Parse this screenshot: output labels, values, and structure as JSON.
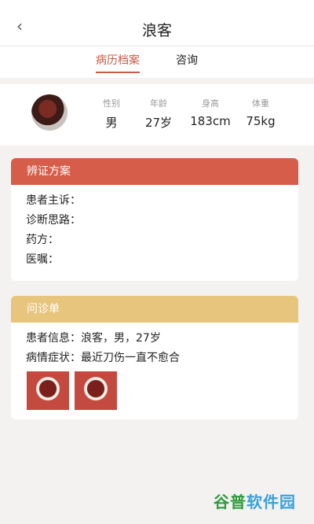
{
  "header": {
    "title": "浪客"
  },
  "tabs": [
    {
      "label": "病历档案",
      "active": true
    },
    {
      "label": "咨询",
      "active": false
    }
  ],
  "profile": {
    "stats": [
      {
        "label": "性别",
        "value": "男"
      },
      {
        "label": "年龄",
        "value": "27岁"
      },
      {
        "label": "身高",
        "value": "183cm"
      },
      {
        "label": "体重",
        "value": "75kg"
      }
    ]
  },
  "plan": {
    "title": "辨证方案",
    "lines": [
      "患者主诉：",
      "诊断思路：",
      "药方：",
      "医嘱："
    ]
  },
  "consult": {
    "title": "问诊单",
    "lines": [
      "患者信息：浪客，男，27岁",
      "病情症状：最近刀伤一直不愈合"
    ]
  },
  "colors": {
    "accent": "#c85b45",
    "plan_head": "#d65d49",
    "consult_head": "#e8c57c"
  },
  "watermark": {
    "part1": "谷普",
    "part2": "软件园"
  }
}
